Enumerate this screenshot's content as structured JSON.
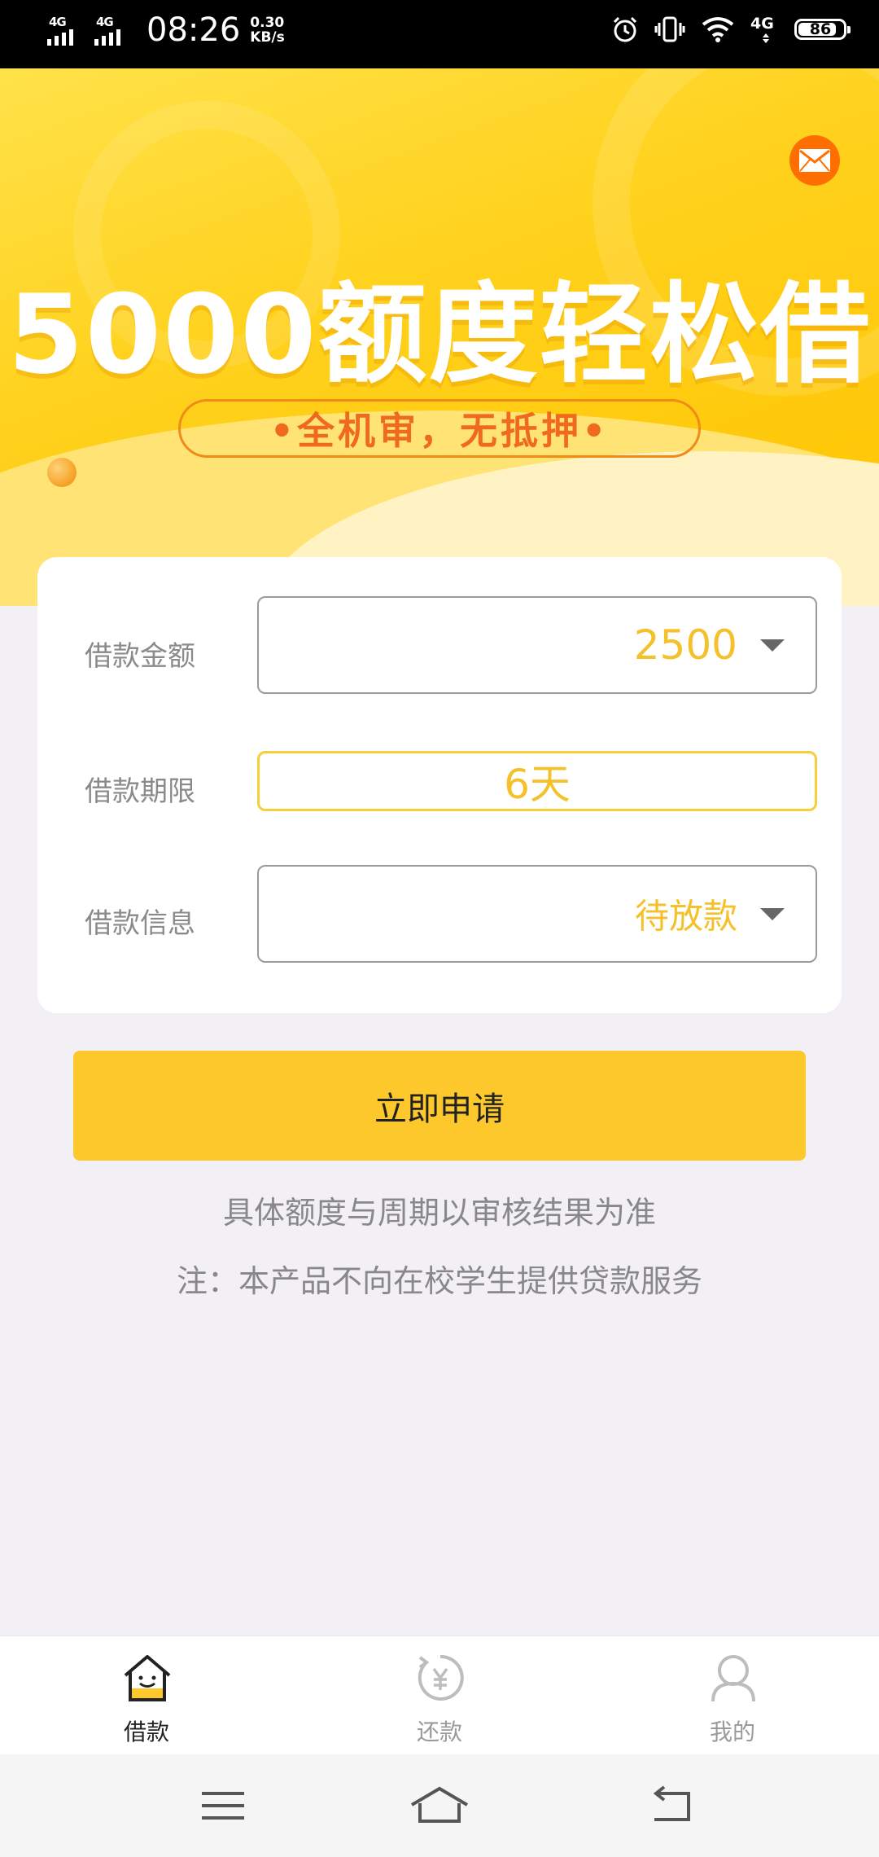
{
  "status_bar": {
    "network_left": "4G",
    "network_right": "4G",
    "time": "08:26",
    "speed_value": "0.30",
    "speed_unit": "KB/s",
    "net_type": "4G",
    "battery": "86",
    "icons": [
      "signal-icon",
      "signal-icon",
      "alarm-icon",
      "vibrate-icon",
      "wifi-icon",
      "battery-icon"
    ]
  },
  "banner": {
    "headline": "5000额度轻松借",
    "tagline": "•全机审，无抵押•",
    "accent_color": "#ffd21e"
  },
  "form": {
    "rows": [
      {
        "label": "借款金额",
        "value": "2500"
      },
      {
        "label": "借款期限",
        "value": "6天"
      },
      {
        "label": "借款信息",
        "value": "待放款"
      }
    ],
    "value_color": "#f5c12a"
  },
  "actions": {
    "apply_label": "立即申请",
    "button_color": "#fcc82c"
  },
  "notes": {
    "line1": "具体额度与周期以审核结果为准",
    "line2": "注：本产品不向在校学生提供贷款服务"
  },
  "tabbar": {
    "items": [
      {
        "label": "借款",
        "icon": "home-smile-icon",
        "active": true
      },
      {
        "label": "还款",
        "icon": "refresh-yen-icon",
        "active": false
      },
      {
        "label": "我的",
        "icon": "person-icon",
        "active": false
      }
    ]
  }
}
